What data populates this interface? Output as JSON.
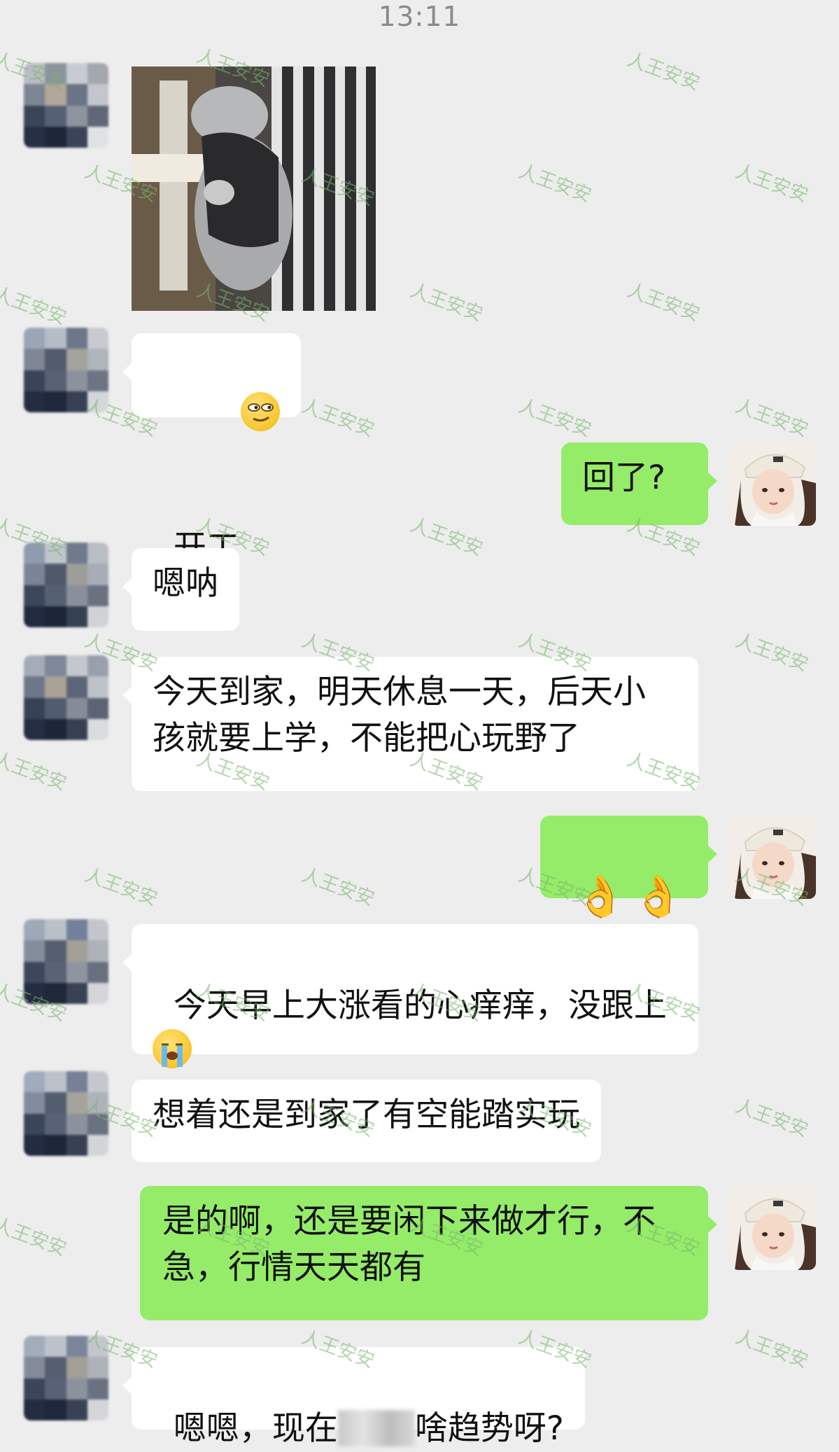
{
  "status": {
    "time": "13:11"
  },
  "watermark": "人王安安",
  "messages": {
    "m2": {
      "text": "开工",
      "emoji": "smirk-face"
    },
    "m3": {
      "text": "回了?"
    },
    "m4": {
      "text": "嗯呐"
    },
    "m5": {
      "text": "今天到家，明天休息一天，后天小\n孩就要上学，不能把心玩野了"
    },
    "m6": {
      "text": "👌👌👌"
    },
    "m7": {
      "text": "今天早上大涨看的心痒痒，没跟上",
      "emoji": "crying-face"
    },
    "m8": {
      "text": "想着还是到家了有空能踏实玩"
    },
    "m9": {
      "text": "是的啊，还是要闲下来做才行，不\n急，行情天天都有"
    },
    "m10": {
      "text_before": "嗯嗯，现在",
      "text_after": "啥趋势呀?"
    }
  },
  "colors": {
    "background": "#ededed",
    "bubble_incoming": "#ffffff",
    "bubble_outgoing": "#95ec69"
  }
}
